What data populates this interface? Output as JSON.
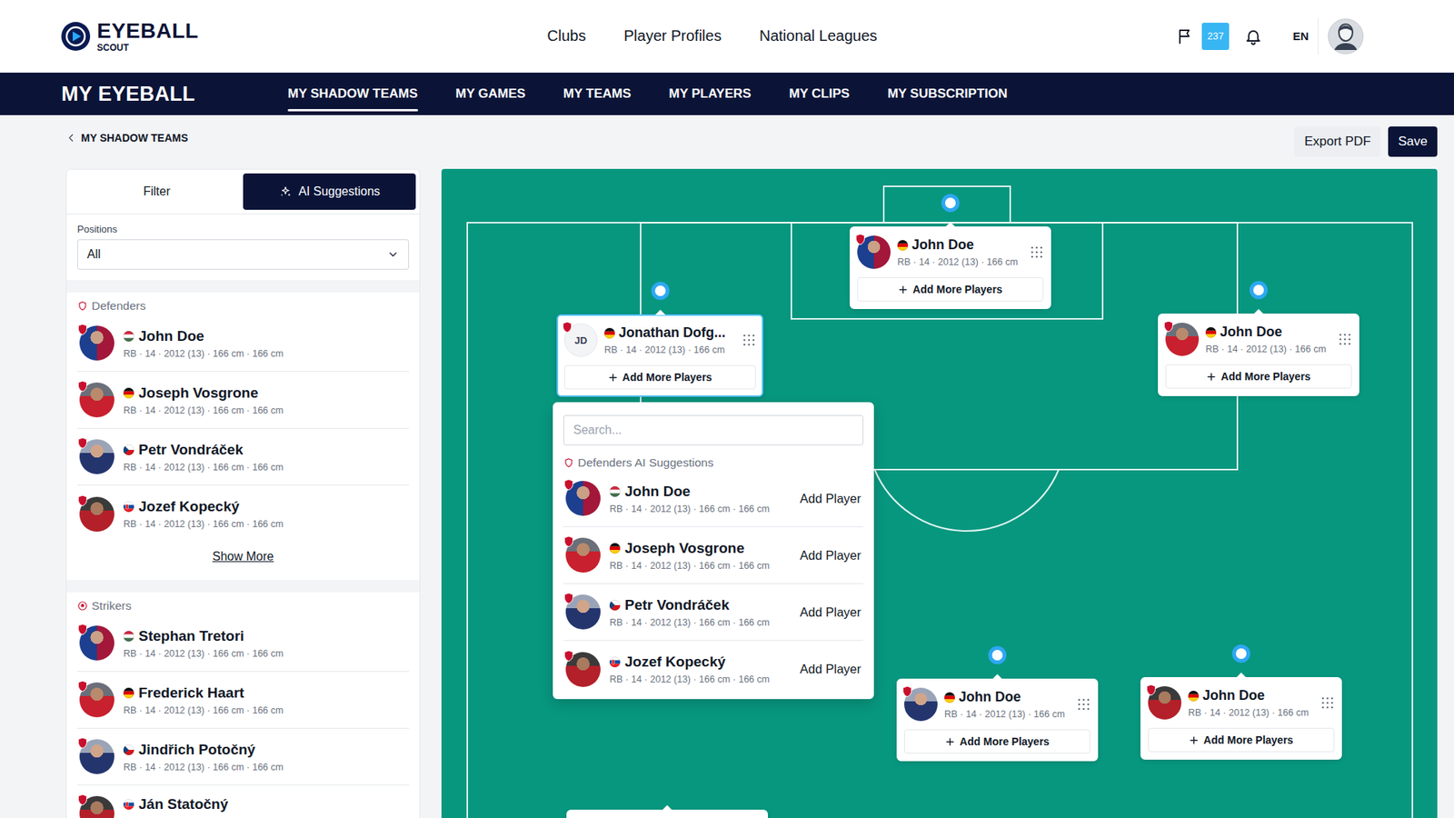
{
  "header": {
    "logo": {
      "title": "EYEBALL",
      "subtitle": "SCOUT"
    },
    "nav": [
      {
        "label": "Clubs"
      },
      {
        "label": "Player Profiles"
      },
      {
        "label": "National Leagues"
      }
    ],
    "badge": "237",
    "language": "EN"
  },
  "subnav": {
    "title": "MY EYEBALL",
    "tabs": [
      {
        "label": "MY SHADOW TEAMS",
        "selected": true
      },
      {
        "label": "MY GAMES",
        "selected": false
      },
      {
        "label": "MY TEAMS",
        "selected": false
      },
      {
        "label": "MY PLAYERS",
        "selected": false
      },
      {
        "label": "MY CLIPS",
        "selected": false
      },
      {
        "label": "MY SUBSCRIPTION",
        "selected": false
      }
    ]
  },
  "breadcrumb": {
    "label": "MY SHADOW TEAMS"
  },
  "actions": [
    {
      "label": "Export PDF",
      "kind": "secondary"
    },
    {
      "label": "Save",
      "kind": "primary"
    }
  ],
  "sidebar": {
    "tabs": [
      {
        "label": "Filter",
        "selected": false
      },
      {
        "label": "AI Suggestions",
        "selected": true
      }
    ],
    "positions": {
      "label": "Positions",
      "value": "All"
    },
    "groups": [
      {
        "title": "Defenders",
        "kind": "defender",
        "more": "Show More",
        "players": [
          {
            "name": "John Doe",
            "meta": "RB · 14 · 2012 (13) · 166 cm · 166 cm",
            "flag": "hu"
          },
          {
            "name": "Joseph Vosgrone",
            "meta": "RB · 14 · 2012 (13) · 166 cm · 166 cm",
            "flag": "de"
          },
          {
            "name": "Petr Vondráček",
            "meta": "RB · 14 · 2012 (13) · 166 cm · 166 cm",
            "flag": "cz"
          },
          {
            "name": "Jozef Kopecký",
            "meta": "RB · 14 · 2012 (13) · 166 cm · 166 cm",
            "flag": "sk"
          }
        ]
      },
      {
        "title": "Strikers",
        "kind": "striker",
        "players": [
          {
            "name": "Stephan Tretori",
            "meta": "RB · 14 · 2012 (13) · 166 cm · 166 cm",
            "flag": "hu"
          },
          {
            "name": "Frederick Haart",
            "meta": "RB · 14 · 2012 (13) · 166 cm · 166 cm",
            "flag": "de"
          },
          {
            "name": "Jindřich Potočný",
            "meta": "RB · 14 · 2012 (13) · 166 cm · 166 cm",
            "flag": "cz"
          },
          {
            "name": "Ján Statočný",
            "flag": "sk"
          }
        ]
      }
    ]
  },
  "pitch": {
    "cards": [
      {
        "name": "John Doe",
        "meta": "RB · 14 · 2012 (13) · 166 cm",
        "flag": "de",
        "kind": "photo",
        "highlighted": false,
        "add_label": "Add More Players"
      },
      {
        "name": "Jonathan Dofg...",
        "meta": "RB · 14 · 2012 (13) · 166 cm",
        "flag": "de",
        "kind": "initials",
        "initials": "JD",
        "highlighted": true,
        "add_label": "Add More Players"
      },
      {
        "name": "John Doe",
        "meta": "RB · 14 · 2012 (13) · 166 cm",
        "flag": "de",
        "kind": "photo",
        "highlighted": false,
        "add_label": "Add More Players"
      },
      {
        "name": "John Doe",
        "meta": "RB · 14 · 2012 (13) · 166 cm",
        "flag": "de",
        "kind": "photo",
        "highlighted": false,
        "add_label": "Add More Players"
      },
      {
        "name": "John Doe",
        "meta": "RB · 14 · 2012 (13) · 166 cm",
        "flag": "de",
        "kind": "photo",
        "highlighted": false,
        "add_label": "Add More Players"
      }
    ],
    "popup": {
      "search_placeholder": "Search...",
      "title": "Defenders AI Suggestions",
      "players": [
        {
          "name": "John Doe",
          "meta": "RB · 14 · 2012 (13) · 166 cm · 166 cm",
          "flag": "hu",
          "action": "Add Player"
        },
        {
          "name": "Joseph Vosgrone",
          "meta": "RB · 14 · 2012 (13) · 166 cm · 166 cm",
          "flag": "de",
          "action": "Add Player"
        },
        {
          "name": "Petr Vondráček",
          "meta": "RB · 14 · 2012 (13) · 166 cm · 166 cm",
          "flag": "cz",
          "action": "Add Player"
        },
        {
          "name": "Jozef Kopecký",
          "meta": "RB · 14 · 2012 (13) · 166 cm · 166 cm",
          "flag": "sk",
          "action": "Add Player"
        }
      ]
    }
  }
}
